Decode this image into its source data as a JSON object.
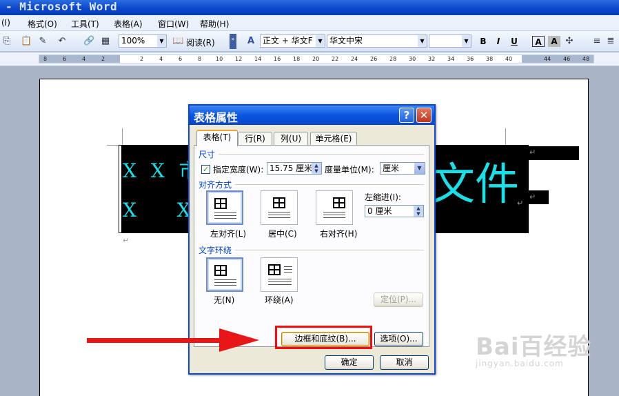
{
  "window": {
    "title": "- Microsoft Word"
  },
  "menu": {
    "items": [
      "(I)",
      "格式(O)",
      "工具(T)",
      "表格(A)",
      "窗口(W)",
      "帮助(H)"
    ]
  },
  "toolbar": {
    "zoom": "100%",
    "read_label": "阅读(R)",
    "style": "正文 + 华文F",
    "font": "华文中宋",
    "size": "",
    "bold": "B",
    "italic": "I",
    "underline": "U",
    "charbox": "A",
    "shade": "A"
  },
  "ruler": {
    "ticks": [
      "8",
      "6",
      "4",
      "2",
      "2",
      "4",
      "6",
      "8",
      "10",
      "12",
      "14",
      "16",
      "18",
      "20",
      "22",
      "24",
      "26",
      "28",
      "30",
      "32",
      "34",
      "36",
      "38",
      "40",
      "44",
      "46",
      "48"
    ]
  },
  "document": {
    "line1": "X X 市",
    "line1_right": "文件",
    "line2": "X   X"
  },
  "dialog": {
    "title": "表格属性",
    "tabs": [
      "表格(T)",
      "行(R)",
      "列(U)",
      "单元格(E)"
    ],
    "size_section": "尺寸",
    "specify_width_label": "指定宽度(W):",
    "width_value": "15.75 厘米",
    "unit_label": "度量单位(M):",
    "unit_value": "厘米",
    "align_section": "对齐方式",
    "align_left": "左对齐(L)",
    "align_center": "居中(C)",
    "align_right": "右对齐(H)",
    "indent_label": "左缩进(I):",
    "indent_value": "0 厘米",
    "wrap_section": "文字环绕",
    "wrap_none": "无(N)",
    "wrap_around": "环绕(A)",
    "position_btn": "定位(P)...",
    "borders_btn": "边框和底纹(B)...",
    "options_btn": "选项(O)...",
    "ok_btn": "确定",
    "cancel_btn": "取消"
  },
  "watermark": {
    "main": "Bai百经验",
    "sub": "jingyan.baidu.com"
  },
  "colors": {
    "highlight": "#ff0a0a",
    "doc_text": "#19e0e8",
    "title_blue": "#0b55e0"
  }
}
